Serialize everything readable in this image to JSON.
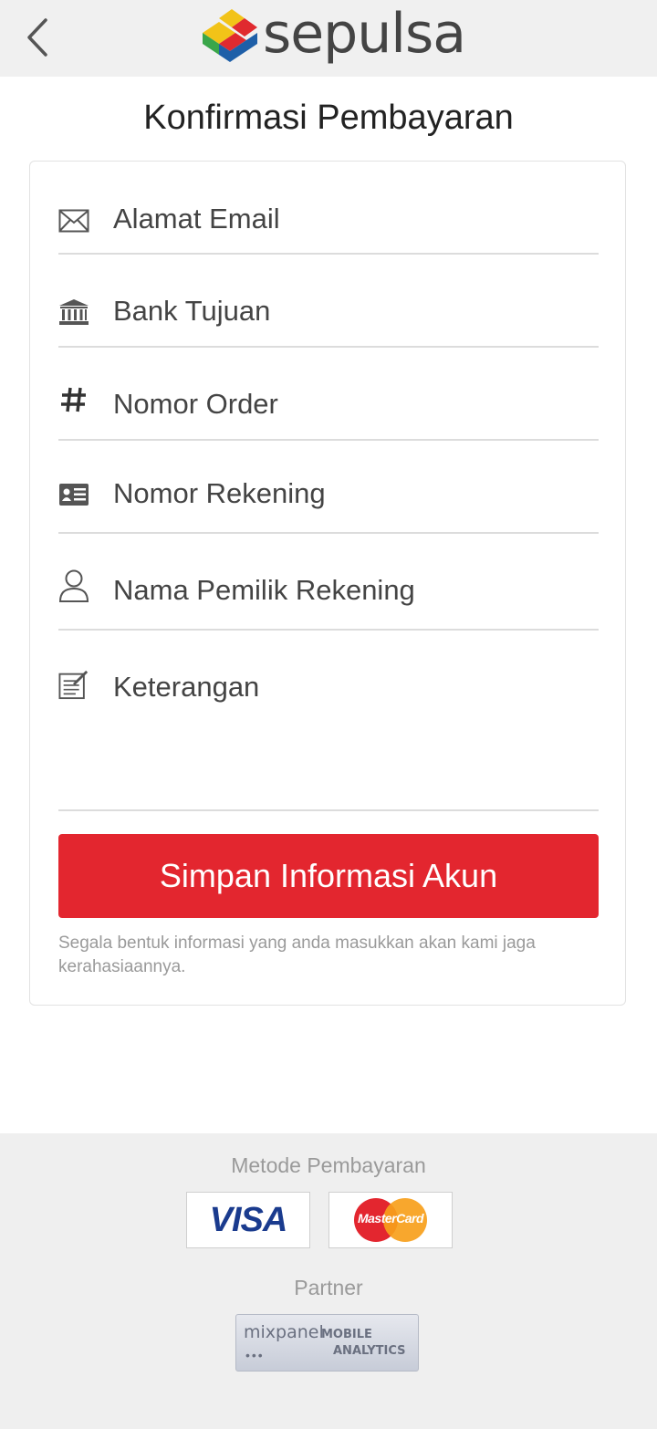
{
  "header": {
    "back_icon": "chevron-left-icon",
    "logo_text": "sepulsa"
  },
  "page_title": "Konfirmasi Pembayaran",
  "form": {
    "fields": [
      {
        "icon": "envelope-icon",
        "placeholder": "Alamat Email"
      },
      {
        "icon": "bank-icon",
        "placeholder": "Bank Tujuan"
      },
      {
        "icon": "hash-icon",
        "placeholder": "Nomor Order"
      },
      {
        "icon": "id-card-icon",
        "placeholder": "Nomor Rekening"
      },
      {
        "icon": "user-icon",
        "placeholder": "Nama Pemilik Rekening"
      },
      {
        "icon": "note-edit-icon",
        "placeholder": "Keterangan"
      }
    ],
    "submit_label": "Simpan Informasi Akun",
    "privacy_note": "Segala bentuk informasi yang anda masukkan akan kami jaga kerahasiaannya."
  },
  "footer": {
    "payment_heading": "Metode Pembayaran",
    "payment_methods": [
      "VISA",
      "MasterCard"
    ],
    "partner_heading": "Partner",
    "partner": {
      "name": "mixpanel",
      "tagline_1": "MOBILE",
      "tagline_2": "ANALYTICS"
    }
  },
  "colors": {
    "accent_red": "#e3262f",
    "header_bg": "#f0f0f0",
    "footer_bg": "#efefef"
  }
}
